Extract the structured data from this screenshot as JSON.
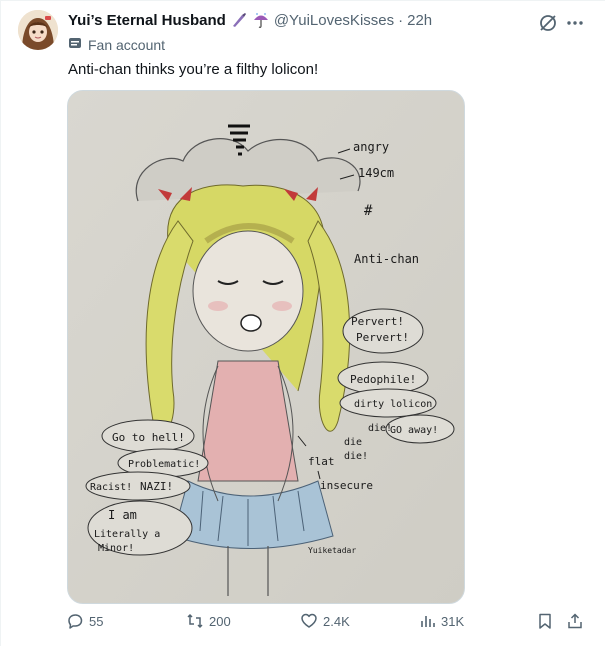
{
  "post": {
    "author": {
      "display_name": "Yui’s Eternal Husband",
      "handle": "@YuiLovesKisses",
      "emojis": [
        "knife-emoji",
        "umbrella-emoji"
      ]
    },
    "separator": "·",
    "timestamp": "22h",
    "label": "Fan account",
    "text": "Anti-chan thinks you’re a filthy lolicon!",
    "media": {
      "annotations": {
        "angry": "angry",
        "height": "149cm",
        "name": "Anti-chan",
        "pervert1": "Pervert!",
        "pervert2": "Pervert!",
        "pedophile": "Pedophile!",
        "dirty": "dirty lolicon",
        "die1": "die!",
        "go_away": "GO away!",
        "die2": "die",
        "die3": "die!",
        "flat": "flat",
        "insecure": "insecure",
        "go_to_hell": "Go to hell!",
        "problematic": "Problematic!",
        "racist": "Racist!",
        "nazi": "NAZI!",
        "i_am": "I am",
        "literally": "Literally a",
        "minor": "Minor!",
        "signature": "Yuiketadar"
      }
    },
    "actions": {
      "replies": "55",
      "reposts": "200",
      "likes": "2.4K",
      "views": "31K"
    }
  },
  "colors": {
    "text_primary": "#0f1419",
    "text_secondary": "#536471",
    "border": "#cfd9de"
  }
}
